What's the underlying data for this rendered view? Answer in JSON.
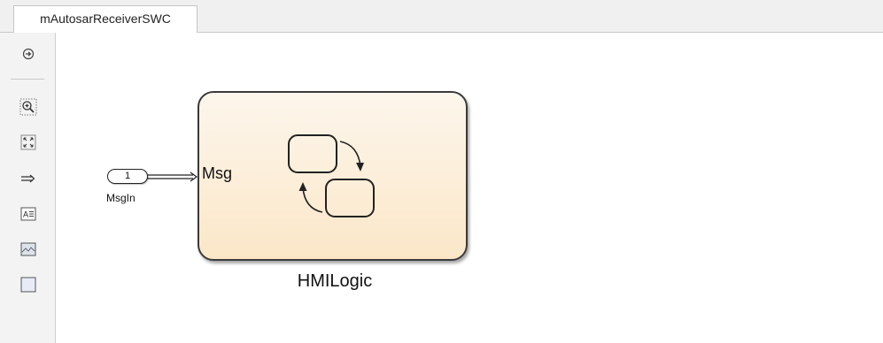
{
  "tabs": [
    {
      "label": "mAutosarReceiverSWC"
    }
  ],
  "toolbar": {
    "items": [
      {
        "icon": "navigate-arrow-icon"
      },
      {
        "icon": "zoom-in-icon"
      },
      {
        "icon": "fit-to-view-icon"
      },
      {
        "icon": "signal-route-icon"
      },
      {
        "icon": "annotation-icon"
      },
      {
        "icon": "image-icon"
      },
      {
        "icon": "area-icon"
      }
    ]
  },
  "diagram": {
    "inport": {
      "number": "1",
      "name": "MsgIn"
    },
    "chart": {
      "name": "HMILogic",
      "input_port_label": "Msg"
    }
  },
  "colors": {
    "chart_fill_top": "#fdf6ec",
    "chart_fill_bottom": "#fbe7c8",
    "border": "#3a3a3a"
  }
}
